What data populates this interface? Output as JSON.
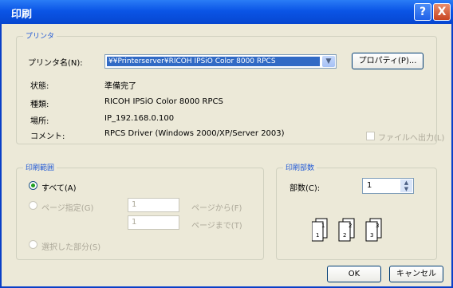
{
  "dialog": {
    "title": "印刷"
  },
  "titlebar": {
    "help_label": "?",
    "close_label": "X"
  },
  "printer": {
    "group_title": "プリンタ",
    "name_label": "プリンタ名(N):",
    "name_value": "¥¥Printerserver¥RICOH IPSiO Color 8000 RPCS",
    "properties_label": "プロパティ(P)...",
    "status_label": "状態:",
    "status_value": "準備完了",
    "type_label": "種類:",
    "type_value": "RICOH IPSiO Color 8000 RPCS",
    "location_label": "場所:",
    "location_value": "IP_192.168.0.100",
    "comment_label": "コメント:",
    "comment_value": "RPCS Driver (Windows 2000/XP/Server 2003)",
    "print_to_file_label": "ファイルへ出力(L)",
    "dropdown_icon": "chevron-down-icon"
  },
  "range": {
    "group_title": "印刷範囲",
    "all_label": "すべて(A)",
    "pages_label": "ページ指定(G)",
    "from_value": "1",
    "from_label": "ページから(F)",
    "to_value": "1",
    "to_label": "ページまで(T)",
    "selection_label": "選択した部分(S)"
  },
  "copies": {
    "group_title": "印刷部数",
    "count_label": "部数(C):",
    "count_value": "1",
    "icon_pages": [
      "1",
      "1",
      "2",
      "2",
      "3",
      "3"
    ]
  },
  "buttons": {
    "ok_label": "OK",
    "cancel_label": "キャンセル"
  }
}
